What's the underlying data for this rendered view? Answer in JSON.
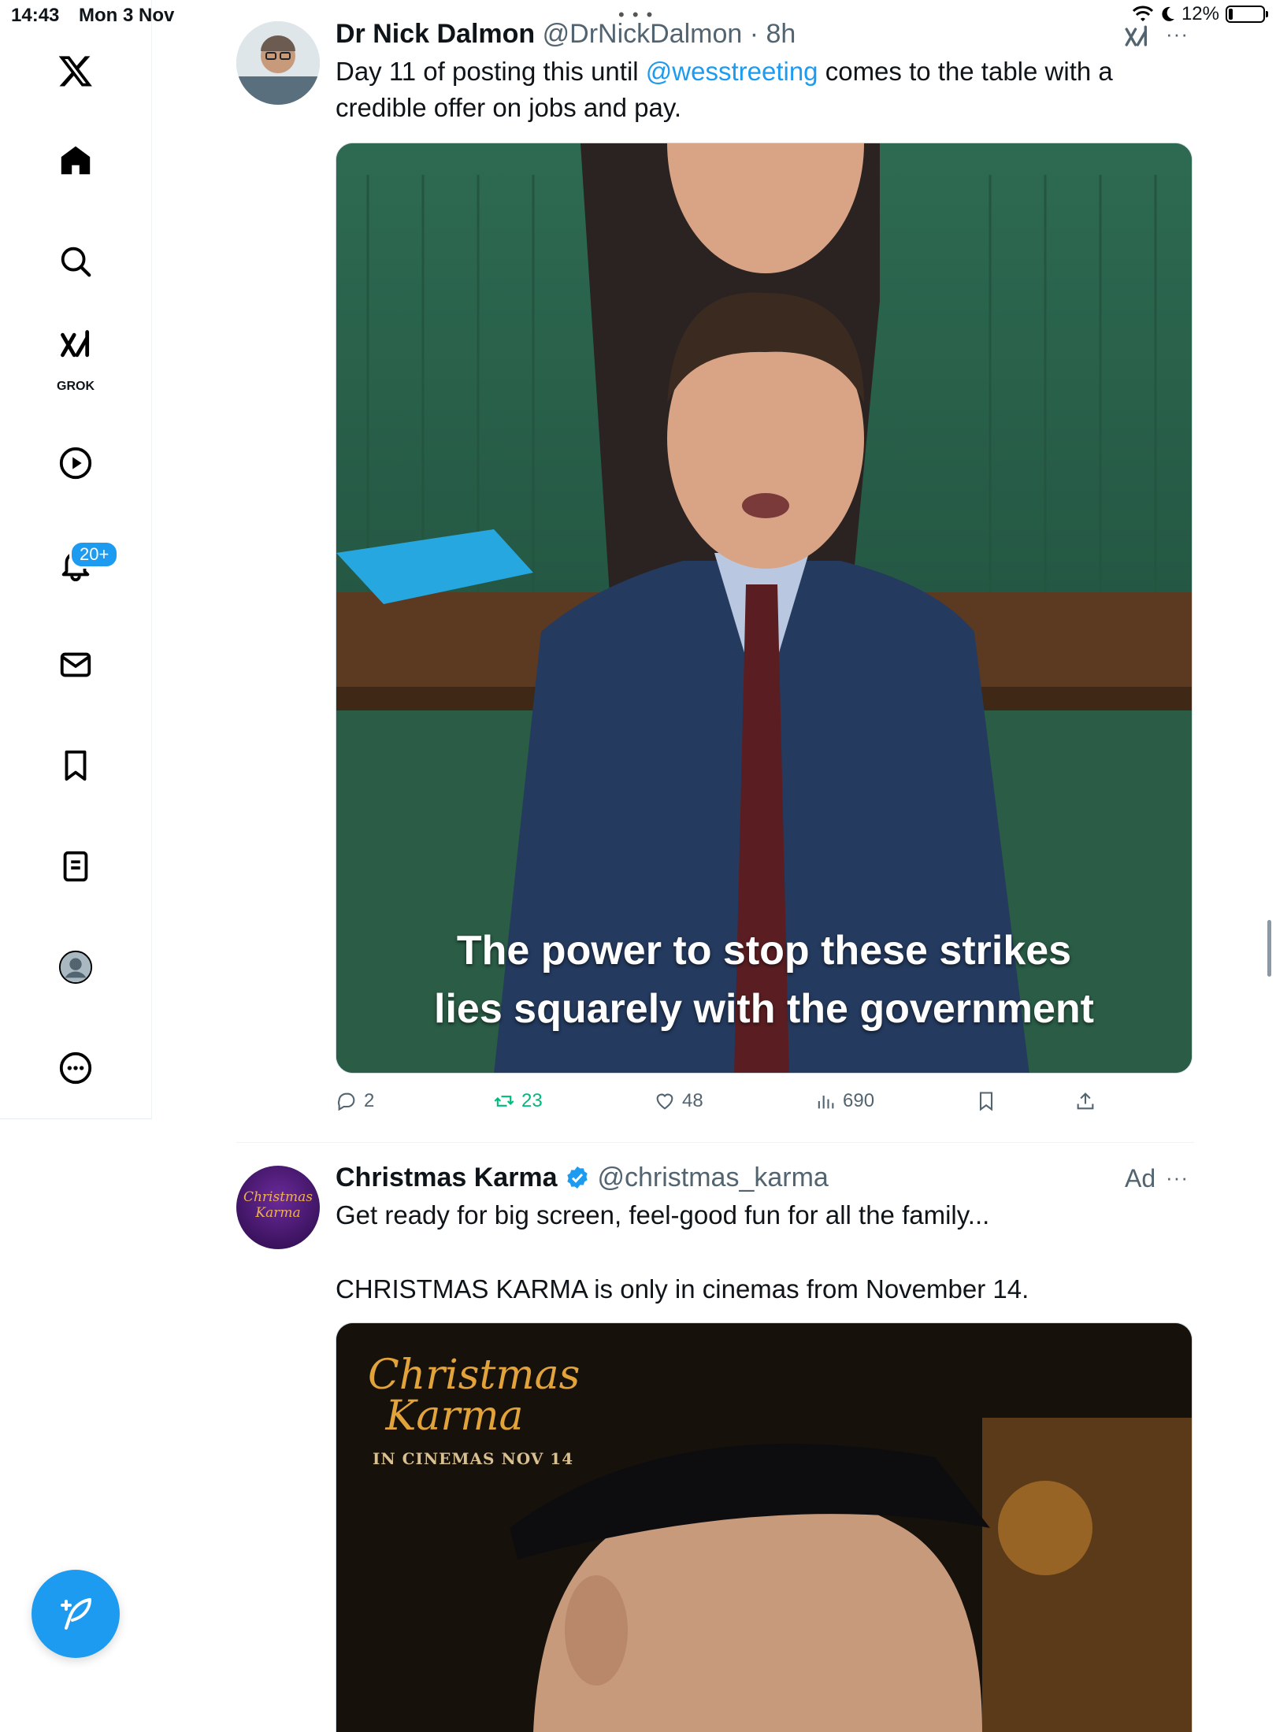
{
  "status_bar": {
    "time": "14:43",
    "date": "Mon 3 Nov",
    "battery": "12%",
    "battery_level": 0.12
  },
  "sidebar": {
    "grok_label": "GROK",
    "notifications_badge": "20+"
  },
  "tweet1": {
    "name": "Dr Nick Dalmon",
    "handle": "@DrNickDalmon",
    "time": "8h",
    "text_before": "Day 11 of posting this until ",
    "mention": "@wesstreeting",
    "text_after": " comes to the table with a credible offer on jobs and pay.",
    "video_caption_line1": "The power to stop these strikes",
    "video_caption_line2": "lies squarely with the government",
    "replies": "2",
    "reposts": "23",
    "likes": "48",
    "views": "690"
  },
  "tweet2": {
    "name": "Christmas Karma",
    "handle": "@christmas_karma",
    "ad_label": "Ad",
    "text_line1": "Get ready for big screen, feel-good fun for all the family...",
    "text_line2": "CHRISTMAS KARMA is only in cinemas from November 14.",
    "avatar_text1": "Christmas",
    "avatar_text2": "Karma",
    "poster_title1": "Christmas",
    "poster_title2": "Karma",
    "poster_subtitle": "IN CINEMAS NOV 14"
  },
  "colors": {
    "accent": "#1d9bf0",
    "repost_green": "#00ba7c",
    "secondary_text": "#536471"
  }
}
